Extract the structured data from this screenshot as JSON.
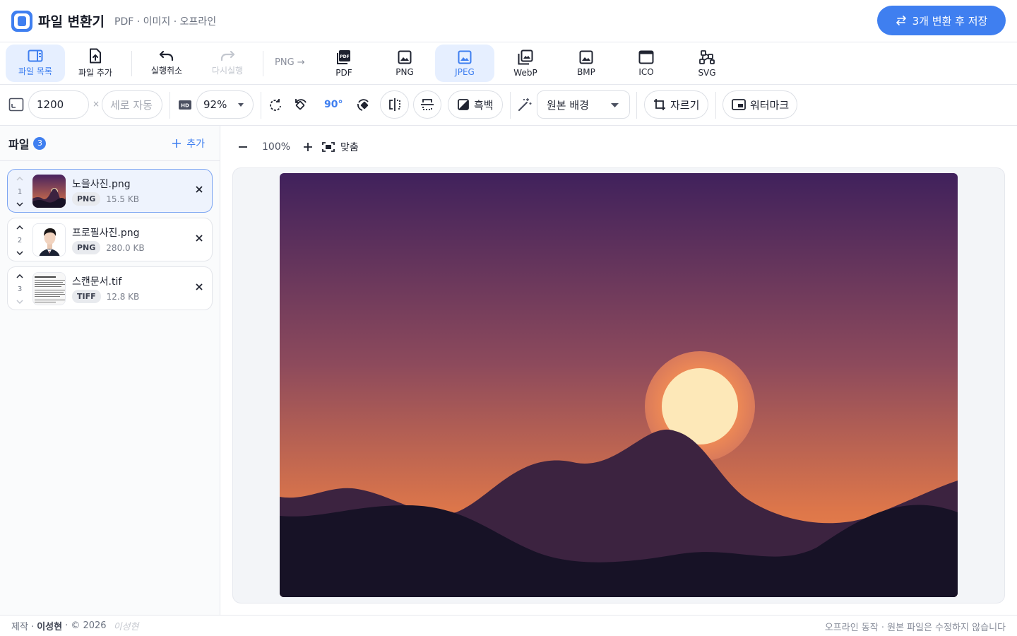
{
  "header": {
    "title": "파일 변환기",
    "subtitle": "PDF · 이미지 · 오프라인",
    "save_button": "3개 변환 후 저장"
  },
  "ribbon": {
    "file_list": "파일 목록",
    "add_file": "파일 추가",
    "undo": "실행취소",
    "redo": "다시실행",
    "source_format": "PNG →",
    "formats": [
      "PDF",
      "PNG",
      "JPEG",
      "WebP",
      "BMP",
      "ICO",
      "SVG"
    ],
    "selected_format": "JPEG"
  },
  "tools": {
    "width_value": "1200",
    "times_sign": "×",
    "height_placeholder": "세로 자동",
    "quality": "92%",
    "rotate_label": "90°",
    "grayscale": "흑백",
    "background": "원본 배경",
    "crop": "자르기",
    "watermark": "워터마크"
  },
  "sidebar": {
    "title": "파일",
    "count": "3",
    "add": "추가",
    "files": [
      {
        "index": "1",
        "name": "노을사진.png",
        "type": "PNG",
        "size": "15.5 KB",
        "selected": true
      },
      {
        "index": "2",
        "name": "프로필사진.png",
        "type": "PNG",
        "size": "280.0 KB",
        "selected": false
      },
      {
        "index": "3",
        "name": "스캔문서.tif",
        "type": "TIFF",
        "size": "12.8 KB",
        "selected": false
      }
    ]
  },
  "viewer": {
    "zoom": "100%",
    "fit": "맞춤"
  },
  "footer": {
    "credit_prefix": "제작 ·",
    "author": "이성현",
    "credit_suffix": "· © 2026",
    "signature": "이성현",
    "note": "오프라인 동작 · 원본 파일은 수정하지 않습니다"
  },
  "colors": {
    "accent": "#3f7ff0",
    "sky_top": "#40215c",
    "sky_bottom": "#e57d47",
    "sun": "#fde8b8",
    "hills_far": "#3c2340",
    "hills_near": "#171226"
  }
}
